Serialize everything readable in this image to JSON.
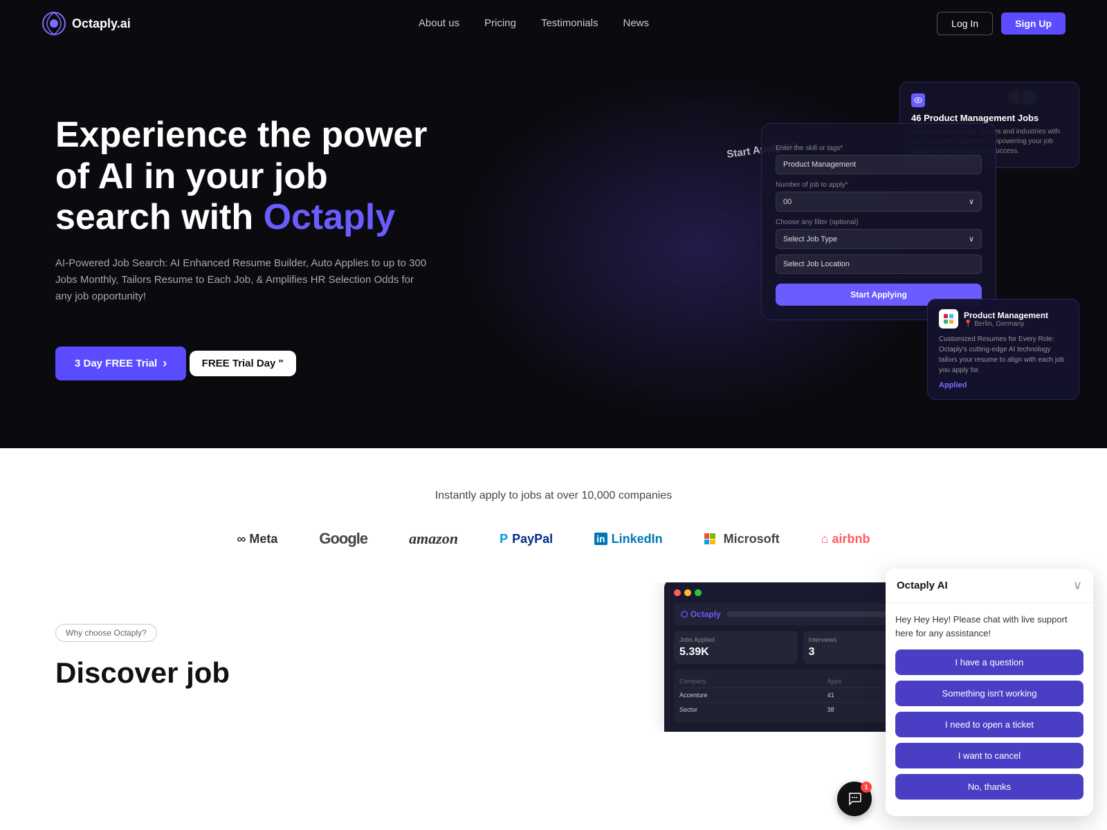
{
  "brand": {
    "name": "Octaply.ai",
    "logo_text": "Octaply.ai"
  },
  "navbar": {
    "links": [
      {
        "label": "About us",
        "id": "about-us"
      },
      {
        "label": "Pricing",
        "id": "pricing"
      },
      {
        "label": "Testimonials",
        "id": "testimonials"
      },
      {
        "label": "News",
        "id": "news"
      }
    ],
    "login_label": "Log In",
    "signup_label": "Sign Up"
  },
  "hero": {
    "title_part1": "Experience the power of AI in your job search with ",
    "title_accent": "Octaply",
    "subtitle": "AI-Powered Job Search: AI Enhanced Resume Builder, Auto Applies to up to 300 Jobs Monthly, Tailors Resume to Each Job, & Amplifies HR Selection Odds for any job opportunity!",
    "cta_label": "3 Day FREE Trial",
    "cta_arrow": "›"
  },
  "hero_card_jobs": {
    "count": "46 Product Management Jobs",
    "desc": "Explore a wide range of roles and industries with our AI-powered platform, empowering your job search with efficiency and success."
  },
  "hero_card_main": {
    "title": "Start Applying",
    "field1_label": "Enter the skill or tags*",
    "field1_value": "Product Management",
    "field2_label": "Number of job to apply*",
    "field2_value": "00",
    "field3_label": "Choose any filter (optional)",
    "field3_value": "Select Job Type",
    "field4_value": "Select Job Location",
    "btn_label": "Start Applying"
  },
  "hero_card_product": {
    "title": "Product Management",
    "location": "Berlin, Germany",
    "desc": "Customized Resumes for Every Role: Octaply's cutting-edge AI technology tailors your resume to align with each job you apply for.",
    "status": "Applied"
  },
  "companies": {
    "title": "Instantly apply to jobs at over 10,000 companies",
    "logos": [
      {
        "name": "Meta",
        "symbol": "∞ Meta"
      },
      {
        "name": "Google",
        "symbol": "Google"
      },
      {
        "name": "Amazon",
        "symbol": "amazon"
      },
      {
        "name": "PayPal",
        "symbol": "PayPal"
      },
      {
        "name": "LinkedIn",
        "symbol": "Linked in"
      },
      {
        "name": "Microsoft",
        "symbol": "⊞ Microsoft"
      },
      {
        "name": "Airbnb",
        "symbol": "⌂ airbnb"
      }
    ]
  },
  "discover": {
    "tag": "Why choose Octaply?",
    "title": "Discover job"
  },
  "free_trial_badge": {
    "text": "FREE Trial Day \""
  },
  "chat": {
    "title": "Octaply AI",
    "message": "Hey Hey Hey! Please chat with live support here for any assistance!",
    "buttons": [
      {
        "label": "I have a question",
        "id": "question-btn"
      },
      {
        "label": "Something isn't working",
        "id": "not-working-btn"
      },
      {
        "label": "I need to open a ticket",
        "id": "ticket-btn"
      },
      {
        "label": "I want to cancel",
        "id": "cancel-btn"
      },
      {
        "label": "No, thanks",
        "id": "thanks-btn"
      }
    ],
    "close_icon": "chevron-down",
    "notification_count": "1"
  }
}
